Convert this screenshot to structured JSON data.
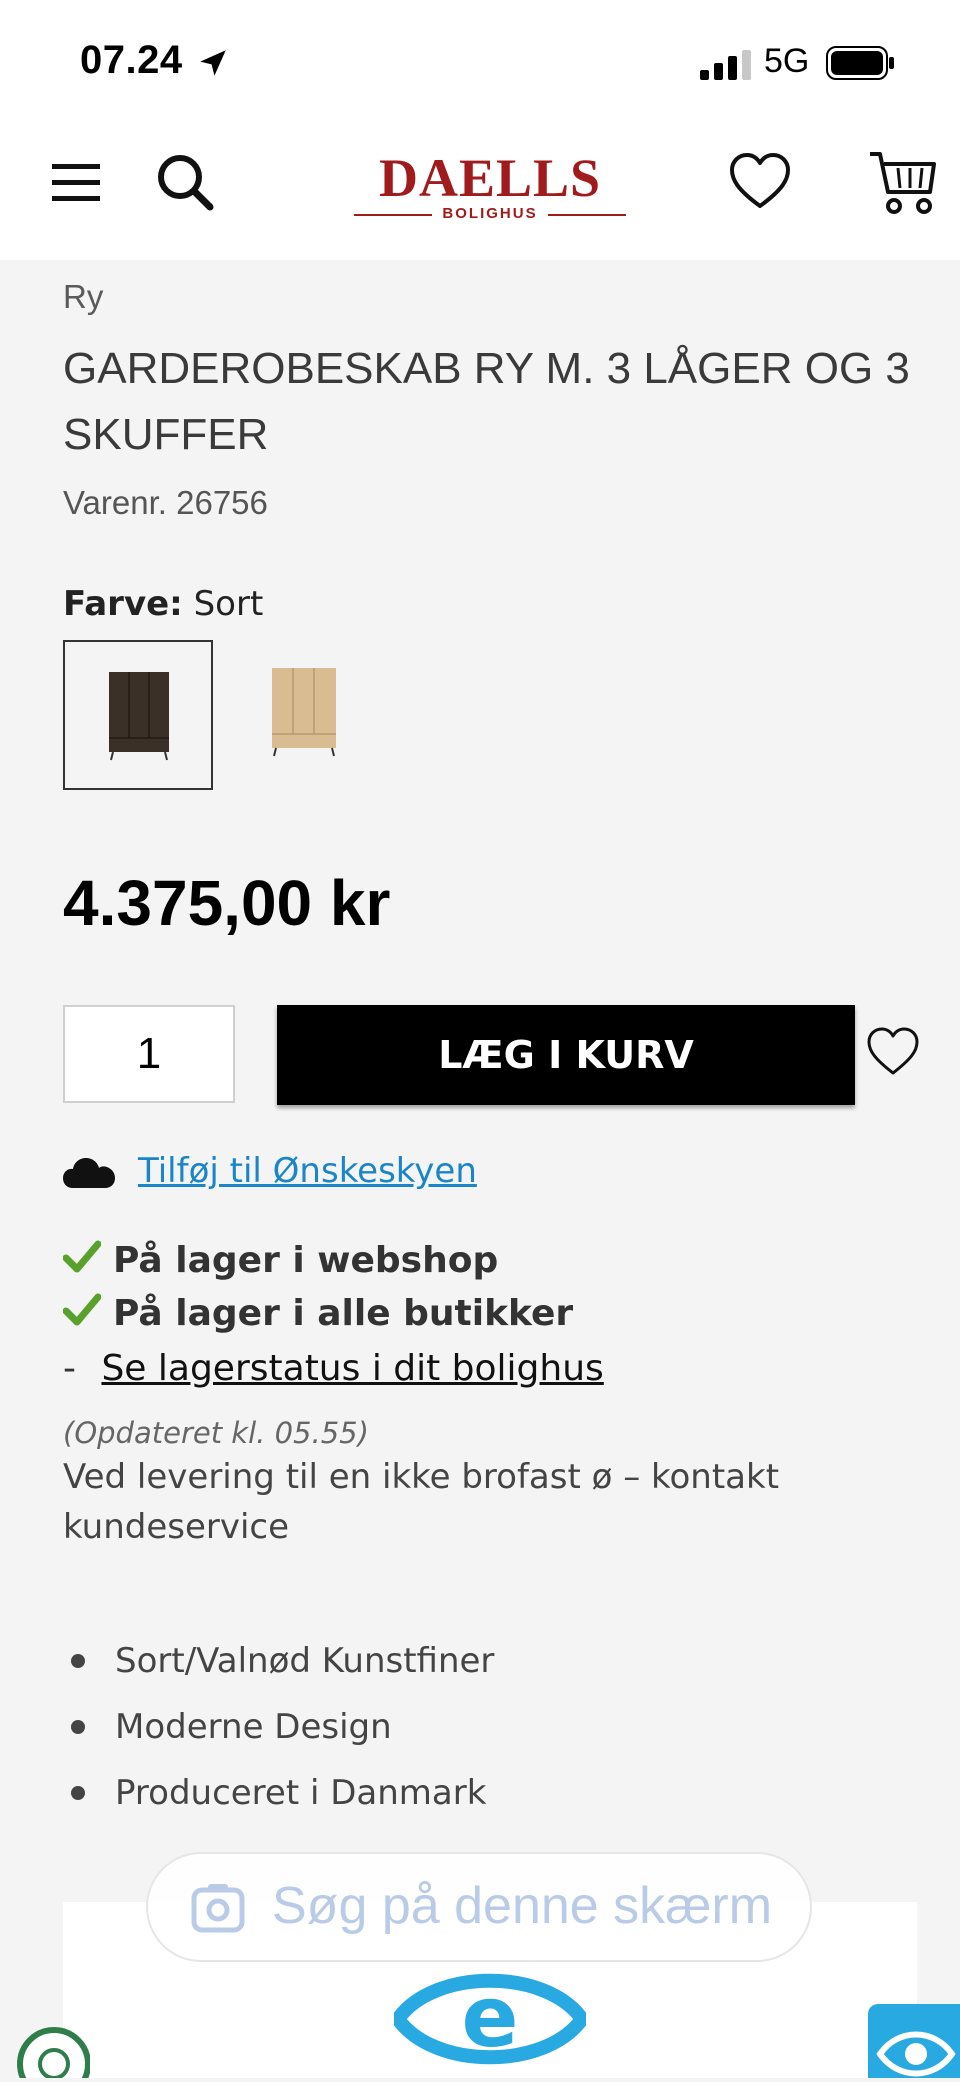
{
  "status_bar": {
    "time": "07.24",
    "network": "5G"
  },
  "header": {
    "logo_title": "DAELLS",
    "logo_subtitle": "BOLIGHUS",
    "icons": [
      "menu-icon",
      "search-icon",
      "heart-icon",
      "cart-icon"
    ]
  },
  "product": {
    "breadcrumb": "Ry",
    "title": "GARDEROBESKAB RY M. 3 LÅGER OG 3 SKUFFER",
    "sku": "Varenr. 26756",
    "color_label": "Farve:",
    "color_value": "Sort",
    "swatches": [
      "Sort",
      "Eg"
    ],
    "price": "4.375,00 kr",
    "quantity": "1",
    "add_to_cart": "LÆG I KURV",
    "wishlist_link": "Tilføj til Ønskeskyen",
    "stock": [
      "På lager i webshop",
      "På lager i alle butikker"
    ],
    "stock_link_prefix": "-",
    "stock_link": "Se lagerstatus i dit bolighus",
    "updated": "(Opdateret kl. 05.55)",
    "delivery_note": "Ved levering til en ikke brofast ø – kontakt kundeservice",
    "features": [
      "Sort/Valnød Kunstfiner",
      "Moderne Design",
      "Produceret i Danmark"
    ]
  },
  "lens_overlay": {
    "label": "Søg på denne skærm"
  },
  "colors": {
    "brand": "#a01c1c",
    "link": "#1a86c8",
    "check": "#5aa02c",
    "badge": "#29a9e1"
  }
}
